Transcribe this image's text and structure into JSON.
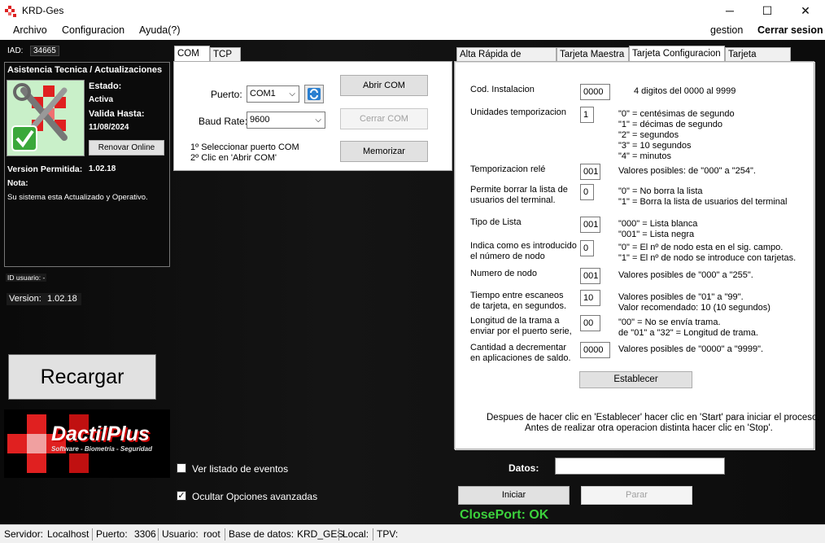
{
  "window": {
    "title": "KRD-Ges",
    "minimize": "─",
    "maximize": "☐",
    "close": "✕"
  },
  "menu": {
    "archivo": "Archivo",
    "configuracion": "Configuracion",
    "ayuda": "Ayuda(?)",
    "gestion": "gestion",
    "cerrar_sesion": "Cerrar sesion"
  },
  "left": {
    "iad_label": "IAD:",
    "iad_value": "34665",
    "support_title": "Asistencia Tecnica / Actualizaciones",
    "estado_label": "Estado:",
    "estado_value": "Activa",
    "valida_label": "Valida Hasta:",
    "valida_value": "11/08/2024",
    "renovar": "Renovar Online",
    "version_permitida_label": "Version Permitida:",
    "version_permitida_value": "1.02.18",
    "nota_label": "Nota:",
    "nota_value": "Su sistema esta Actualizado y Operativo.",
    "id_usuario": "ID usuario: -",
    "version_label": "Version:",
    "version_value": "1.02.18",
    "recargar": "Recargar",
    "logo_text": "DactilPlus",
    "logo_sub": "Software - Biometria - Seguridad"
  },
  "com": {
    "tabs": [
      "COM",
      "TCP"
    ],
    "puerto_label": "Puerto:",
    "puerto_value": "COM1",
    "baud_label": "Baud Rate:",
    "baud_value": "9600",
    "abrir": "Abrir COM",
    "cerrar": "Cerrar COM",
    "memorizar": "Memorizar",
    "hint1": "1º Seleccionar puerto COM",
    "hint2": "2º Clic en 'Abrir COM'"
  },
  "cards": {
    "tabs": [
      "Alta Rápida de Tarjetas",
      "Tarjeta Maestra",
      "Tarjeta Configuracion",
      "Tarjeta Usuario"
    ],
    "rows": [
      {
        "label": "Cod. Instalacion",
        "value": "0000",
        "desc": "4 digitos del 0000 al 9999"
      },
      {
        "label": "Unidades temporizacion",
        "value": "1",
        "desc": "\"0\" = centésimas de segundo\n\"1\" = décimas de segundo\n\"2\" = segundos\n\"3\" = 10 segundos\n\"4\" = minutos"
      },
      {
        "label": "Temporizacion relé",
        "value": "001",
        "desc": "Valores posibles: de \"000\" a \"254\"."
      },
      {
        "label": "Permite borrar la lista de\nusuarios del terminal.",
        "value": "0",
        "desc": "\"0\" = No borra la lista\n\"1\" = Borra la lista de usuarios del terminal"
      },
      {
        "label": "Tipo de Lista",
        "value": "001",
        "desc": "\"000\" = Lista blanca\n\"001\" = Lista negra"
      },
      {
        "label": "Indica como es introducido\nel número de nodo",
        "value": "0",
        "desc": "\"0\" = El nº de nodo esta en el sig. campo.\n\"1\" = El nº de nodo se introduce con tarjetas."
      },
      {
        "label": "Numero de nodo",
        "value": "001",
        "desc": "Valores posibles de \"000\" a \"255\"."
      },
      {
        "label": "Tiempo entre escaneos\nde tarjeta, en segundos.",
        "value": "10",
        "desc": "Valores posibles de \"01\" a \"99\".\nValor recomendado: 10 (10 segundos)"
      },
      {
        "label": "Longitud de la trama a\nenviar por el puerto serie,",
        "value": "00",
        "desc": "\"00\" = No se envía trama.\nde \"01\" a \"32\" = Longitud de trama."
      },
      {
        "label": "Cantidad a decrementar\nen aplicaciones de saldo.",
        "value": "0000",
        "desc": "Valores posibles de \"0000\" a \"9999\"."
      }
    ],
    "establecer": "Establecer",
    "note1": "Despues de hacer clic en 'Establecer' hacer clic en 'Start' para iniciar el proceso.",
    "note2": "Antes de realizar otra operacion distinta hacer clic en 'Stop'."
  },
  "bottom": {
    "ver_listado": "Ver listado de eventos",
    "ocultar": "Ocultar Opciones avanzadas",
    "datos_label": "Datos:",
    "datos_value": "",
    "iniciar": "Iniciar",
    "parar": "Parar",
    "closeport": "ClosePort: OK"
  },
  "status": {
    "servidor_label": "Servidor:",
    "servidor": "Localhost",
    "puerto_label": "Puerto:",
    "puerto": "3306",
    "usuario_label": "Usuario:",
    "usuario": "root",
    "bd_label": "Base de datos:",
    "bd": "KRD_GES",
    "local_label": "Local:",
    "tpv_label": "TPV:"
  }
}
